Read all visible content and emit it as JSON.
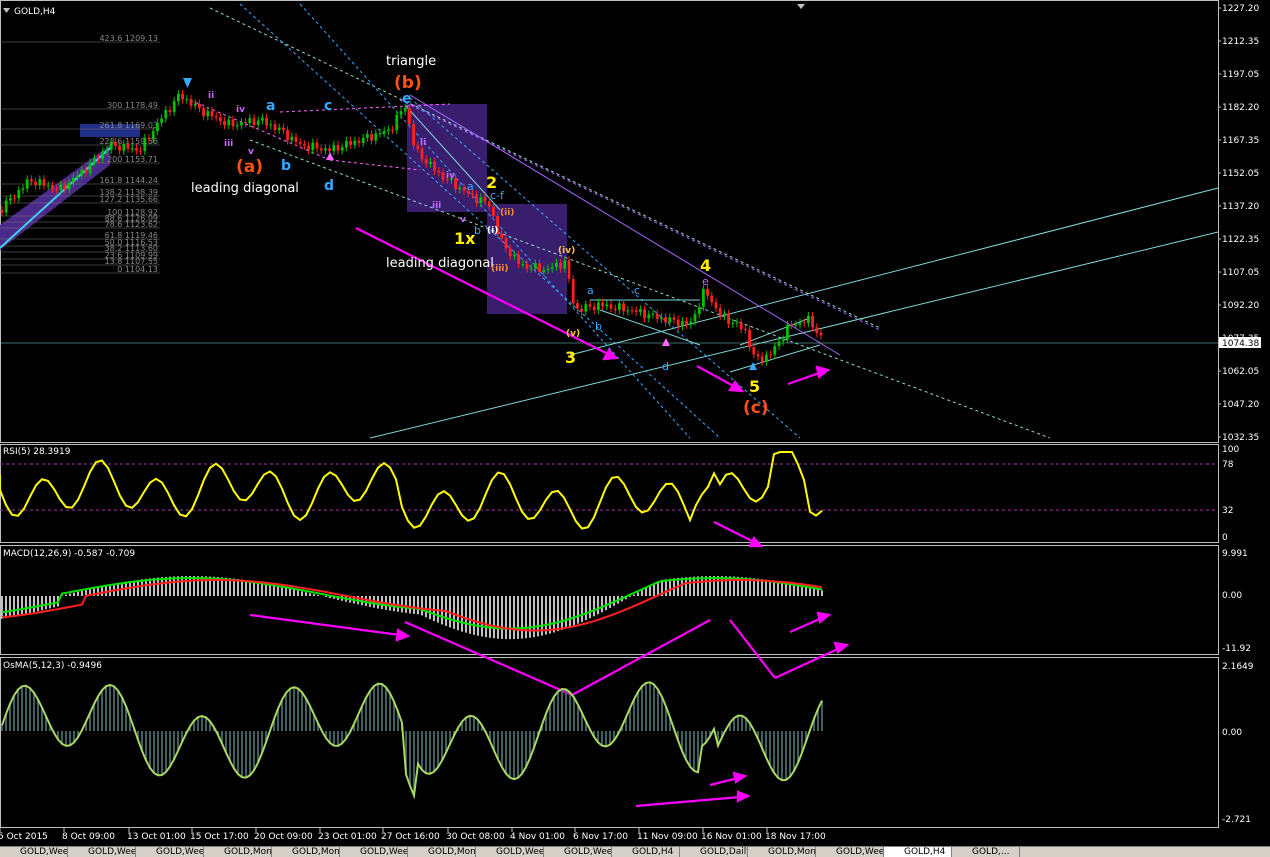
{
  "window": {
    "symbol_title": "GOLD,H4"
  },
  "colors": {
    "background": "#000000",
    "bull_candle": "#00c000",
    "bear_candle": "#ff2020",
    "rsi_line": "#ffff00",
    "macd_main": "#00e000",
    "macd_signal": "#ff2020",
    "histogram": "#c0c0c0",
    "osma_line": "#a8d860",
    "osma_hist": "#406060",
    "arrow": "#ff00ff",
    "wave_blue": "#33aaff",
    "wave_orange": "#ff5010",
    "wave_yellow": "#ffee00",
    "trend_cyan": "#7fd8d8",
    "triangle_box": "#3a1e6e"
  },
  "price_axis": {
    "ticks": [
      "1227.20",
      "1212.35",
      "1197.05",
      "1182.20",
      "1167.35",
      "1152.05",
      "1137.20",
      "1122.35",
      "1107.05",
      "1092.20",
      "1077.35",
      "1062.05",
      "1047.20",
      "1032.35"
    ],
    "current_price": "1074.38"
  },
  "fibonacci_levels": [
    "423.6 1209.13",
    "300 1178.49",
    "261.8 1169.03",
    "223.6 1159.56",
    "200 1153.71",
    "161.8 1144.24",
    "138.2 1138.39",
    "127.2 1135.66",
    "100 1128.92",
    "88.6 1126.09",
    "78.6 1123.62",
    "61.8 1119.46",
    "50.0 1116.53",
    "38.2 1113.60",
    "23.6 1109.99",
    "13.8 1107.55",
    "0 1104.13"
  ],
  "wave_labels": {
    "triangle": "triangle",
    "b_paren": "(b)",
    "a_paren": "(a)",
    "c_paren": "(c)",
    "leading_diagonal_1": "leading diagonal",
    "leading_diagonal_2": "leading diagonal",
    "a": "a",
    "b": "b",
    "c": "c",
    "d": "d",
    "e": "e",
    "ii": "ii",
    "iii": "iii",
    "iv": "iv",
    "v": "v",
    "i_paren": "(i)",
    "ii_paren": "(ii)",
    "iii_paren": "(iii)",
    "iv_paren": "(iv)",
    "v_paren": "(v)",
    "w1x": "1x",
    "w2": "2",
    "w3": "3",
    "w4": "4",
    "w5": "5",
    "cf": "c-f"
  },
  "rsi": {
    "title": "RSI(5) 28.3919",
    "levels": [
      "100",
      "78",
      "32",
      "0"
    ]
  },
  "macd": {
    "title": "MACD(12,26,9) -0.587 -0.709",
    "levels": [
      "9.991",
      "0.00",
      "-11.92"
    ]
  },
  "osma": {
    "title": "OsMA(5,12,3) -0.9496",
    "levels": [
      "2.1649",
      "0.00",
      "-2.721"
    ]
  },
  "time_axis": [
    "5 Oct 2015",
    "8 Oct 09:00",
    "13 Oct 01:00",
    "15 Oct 17:00",
    "20 Oct 09:00",
    "23 Oct 01:00",
    "27 Oct 16:00",
    "30 Oct 08:00",
    "4 Nov 01:00",
    "6 Nov 17:00",
    "11 Nov 09:00",
    "16 Nov 01:00",
    "18 Nov 17:00"
  ],
  "tabs": [
    {
      "label": "GOLD,Weekly",
      "active": false
    },
    {
      "label": "GOLD,Weekly",
      "active": false
    },
    {
      "label": "GOLD,Weekly",
      "active": false
    },
    {
      "label": "GOLD,Monthly",
      "active": false
    },
    {
      "label": "GOLD,Monthly",
      "active": false
    },
    {
      "label": "GOLD,Weekly",
      "active": false
    },
    {
      "label": "GOLD,Monthly",
      "active": false
    },
    {
      "label": "GOLD,Weekly",
      "active": false
    },
    {
      "label": "GOLD,Weekly",
      "active": false
    },
    {
      "label": "GOLD,H4",
      "active": false
    },
    {
      "label": "GOLD,Daily",
      "active": false
    },
    {
      "label": "GOLD,Monthly",
      "active": false
    },
    {
      "label": "GOLD,Weekly",
      "active": false
    },
    {
      "label": "GOLD,H4",
      "active": true
    },
    {
      "label": "GOLD,...",
      "active": false
    }
  ],
  "icons": {
    "window_menu": "triangle-down-icon",
    "tab_scroll": "scroll-arrows-icon"
  }
}
